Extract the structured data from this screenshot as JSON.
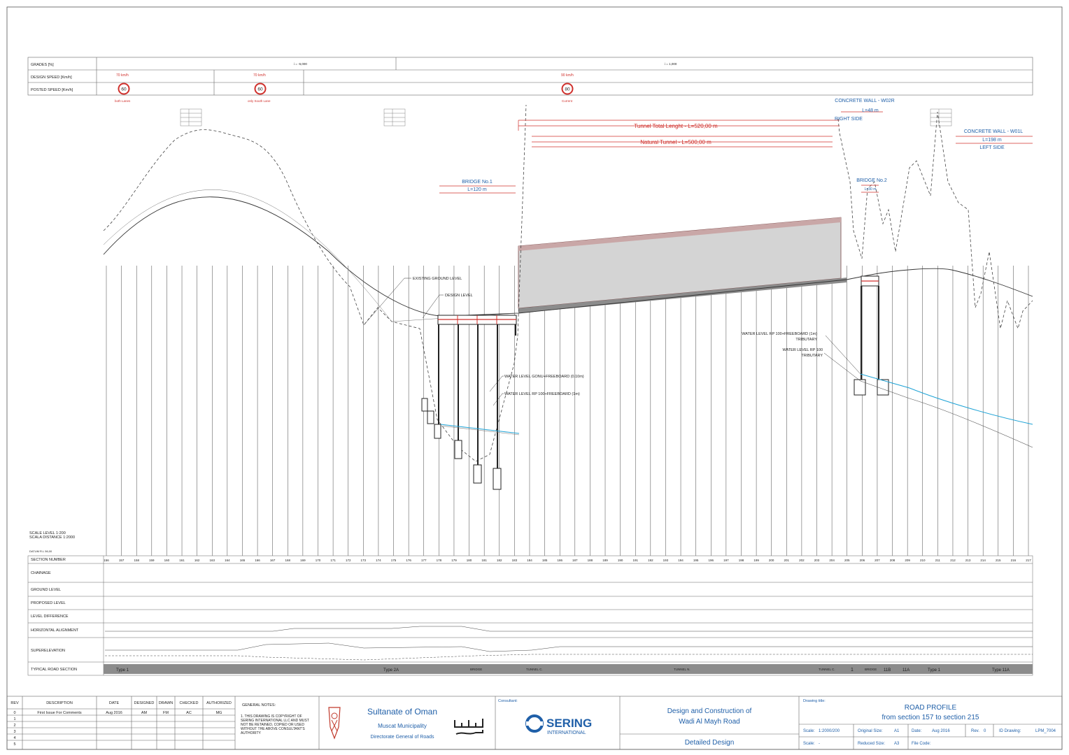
{
  "header_rows": {
    "grades_label": "GRADES [%]",
    "design_speed_label": "DESIGN SPEED [Km/h]",
    "posted_speed_label": "POSTED SPEED [Km/h]",
    "grade_1": "i = -6,000",
    "grade_2": "i = 1,000",
    "speed_1": "70 km/h",
    "speed_2": "70 km/h",
    "speed_3": "90 km/h",
    "sign_1": "60",
    "sign_2": "60",
    "sign_3": "80",
    "sign_1_note": "both Lanes",
    "sign_2_note": "only South Lane",
    "sign_3_note": "Current"
  },
  "annotations": {
    "concrete_wall_r": "CONCRETE WALL - W02R",
    "concrete_wall_r_len": "L=48 m",
    "concrete_wall_r_side": "RIGHT SIDE",
    "concrete_wall_l": "CONCRETE WALL - W01L",
    "concrete_wall_l_len": "L=198 m",
    "concrete_wall_l_side": "LEFT SIDE",
    "tunnel_total": "Tunnel Total Lenght - L=520,00 m",
    "tunnel_natural": "Natural Tunnel - L=500,00 m",
    "bridge1": "BRIDGE No.1",
    "bridge1_len": "L=120 m",
    "bridge2": "BRIDGE No.2",
    "bridge2_len": "L=30 m",
    "existing_ground": "EXISTING GROUND LEVEL",
    "design_level": "DESIGN LEVEL",
    "wl_gonu": "WATER LEVEL GONU+FREEBOARD (0.10m)",
    "wl_rp100_fb": "WATER LEVEL RP 100+FREEBOARD (1m)",
    "wl_trib_fb": "WATER LEVEL RP 100+FREEBOARD (1m)",
    "trib1": "TRIBUTARY",
    "wl_trib": "WATER LEVEL RP 100",
    "trib2": "TRIBUTARY",
    "scale_level": "SCALE LEVEL 1:200",
    "scale_distance": "SCALA DISTANCE 1:2000",
    "datum": "DATUM R.L 56,00"
  },
  "band_labels": [
    "SECTION NUMBER",
    "CHAINAGE",
    "GROUND LEVEL",
    "PROPOSED LEVEL",
    "LEVEL DIFFERENCE",
    "HORIZONTAL ALIGNMENT",
    "SUPERELEVATION",
    "TYPICAL ROAD SECTION"
  ],
  "section_numbers": [
    "156",
    "157",
    "158",
    "159",
    "160",
    "161",
    "162",
    "163",
    "164",
    "165",
    "166",
    "167",
    "168",
    "169",
    "170",
    "171",
    "172",
    "173",
    "174",
    "175",
    "176",
    "177",
    "178",
    "179",
    "180",
    "181",
    "182",
    "183",
    "184",
    "185",
    "186",
    "187",
    "188",
    "189",
    "190",
    "191",
    "192",
    "193",
    "194",
    "195",
    "196",
    "197",
    "198",
    "199",
    "200",
    "201",
    "202",
    "203",
    "204",
    "205",
    "206",
    "207",
    "208",
    "209",
    "210",
    "211",
    "212",
    "213",
    "214",
    "215",
    "216",
    "217"
  ],
  "typical_sections": [
    "Type 1",
    "Type 2A",
    "BRIDGE",
    "TUNNEL C.",
    "TUNNEL N.",
    "TUNNEL C.",
    "1",
    "BRIDGE",
    "11B",
    "11A",
    "Type 1",
    "Type 11A"
  ],
  "title_block": {
    "rev_header": [
      "REV",
      "DESCRIPTION",
      "DATE",
      "DESIGNED",
      "DRAWN",
      "CHECKED",
      "AUTHORIZED"
    ],
    "rev_rows": [
      [
        "0",
        "First Issue For Comments",
        "Aug 2016",
        "AM",
        "FM",
        "AC",
        "MG"
      ],
      [
        "1",
        "",
        "",
        "",
        "",
        "",
        ""
      ],
      [
        "2",
        "",
        "",
        "",
        "",
        "",
        ""
      ],
      [
        "3",
        "",
        "",
        "",
        "",
        "",
        ""
      ],
      [
        "4",
        "",
        "",
        "",
        "",
        "",
        ""
      ],
      [
        "5",
        "",
        "",
        "",
        "",
        "",
        ""
      ]
    ],
    "general_notes_title": "GENERAL NOTES:",
    "general_notes": "1. THIS DRAWING IS COPYRIGHT OF SERING INTERNATIONAL LLC AND MUST NOT BE RETAINED, COPIED OR USED WITHOUT THE ABOVE CONSULTANT'S AUTHORITY",
    "client_name": "Sultanate of Oman",
    "client_line2": "Muscat Municipality",
    "client_line3": "Directorate General of Roads",
    "consultant_label": "Consultant:",
    "consultant_name": "SERING",
    "consultant_sub": "INTERNATIONAL",
    "project_line1": "Design and Construction of",
    "project_line2": "Wadi Al Mayh Road",
    "project_stage": "Detailed Design",
    "drawing_title_label": "Drawing title:",
    "drawing_title_1": "ROAD PROFILE",
    "drawing_title_2": "from section 157 to section 215",
    "scale_label": "Scale:",
    "scale_value": "1:2000/200",
    "original_size_label": "Original Size:",
    "original_size_value": "A1",
    "date_label": "Date:",
    "date_value": "Aug 2016",
    "rev_label": "Rev.",
    "rev_value": "0",
    "id_label": "ID Drawing:",
    "id_value": "LPM_7004",
    "scale2_label": "Scale:",
    "scale2_value": "-",
    "reduced_label": "Reduced Size:",
    "reduced_value": "A3",
    "file_label": "File Code:",
    "file_value": ""
  },
  "colors": {
    "red": "#d0312d",
    "blue": "#1f5fa8",
    "water": "#1fa3d6",
    "tunnel_fill": "#d4d4d4",
    "band_gray": "#8c8c8c"
  }
}
